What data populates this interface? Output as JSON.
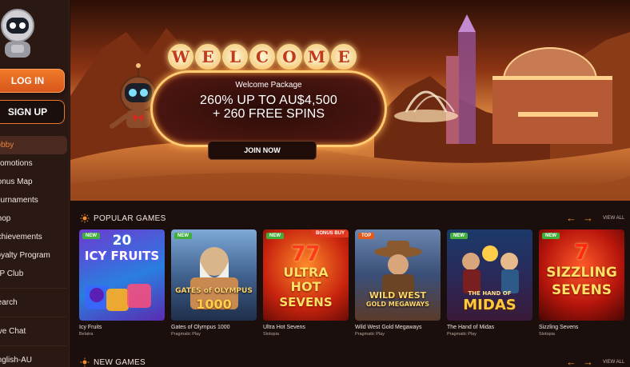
{
  "sidebar": {
    "login_label": "LOG IN",
    "signup_label": "SIGN UP",
    "items": [
      {
        "label": "Lobby",
        "active": true
      },
      {
        "label": "Promotions"
      },
      {
        "label": "Bonus Map"
      },
      {
        "label": "Tournaments"
      },
      {
        "label": "Shop"
      },
      {
        "label": "Achievements"
      },
      {
        "label": "Loyalty Program"
      },
      {
        "label": "VIP Club"
      },
      {
        "label": "Search"
      },
      {
        "label": "Live Chat"
      },
      {
        "label": "English-AU"
      }
    ]
  },
  "banner": {
    "welcome_letters": [
      "W",
      "E",
      "L",
      "C",
      "O",
      "M",
      "E"
    ],
    "subtitle": "Welcome Package",
    "line1": "260% UP TO AU$4,500",
    "line2": "+ 260 FREE SPINS",
    "join_label": "JOIN NOW"
  },
  "popular": {
    "title": "POPULAR GAMES",
    "view_all": "VIEW ALL",
    "games": [
      {
        "name": "Icy Fruits",
        "provider": "Belatra",
        "tag": "NEW",
        "art": "20\nICY FRUITS"
      },
      {
        "name": "Gates of Olympus 1000",
        "provider": "Pragmatic Play",
        "tag": "NEW",
        "art": "GATES of OLYMPUS 1000"
      },
      {
        "name": "Ultra Hot Sevens",
        "provider": "Slotopia",
        "tag": "NEW",
        "corner": "BONUS BUY",
        "art": "ULTRA HOT SEVENS"
      },
      {
        "name": "Wild West Gold Megaways",
        "provider": "Pragmatic Play",
        "tag": "TOP",
        "art": "WILD WEST GOLD MEGAWAYS"
      },
      {
        "name": "The Hand of Midas",
        "provider": "Pragmatic Play",
        "tag": "NEW",
        "art": "THE HAND OF MIDAS"
      },
      {
        "name": "Sizzling Sevens",
        "provider": "Slotopia",
        "tag": "NEW",
        "art": "SIZZLING SEVENS"
      }
    ]
  },
  "new_games": {
    "title": "NEW GAMES",
    "view_all": "VIEW ALL"
  },
  "colors": {
    "accent": "#e9772b",
    "background": "#1a0f0c",
    "sidebar": "#2a1813"
  }
}
